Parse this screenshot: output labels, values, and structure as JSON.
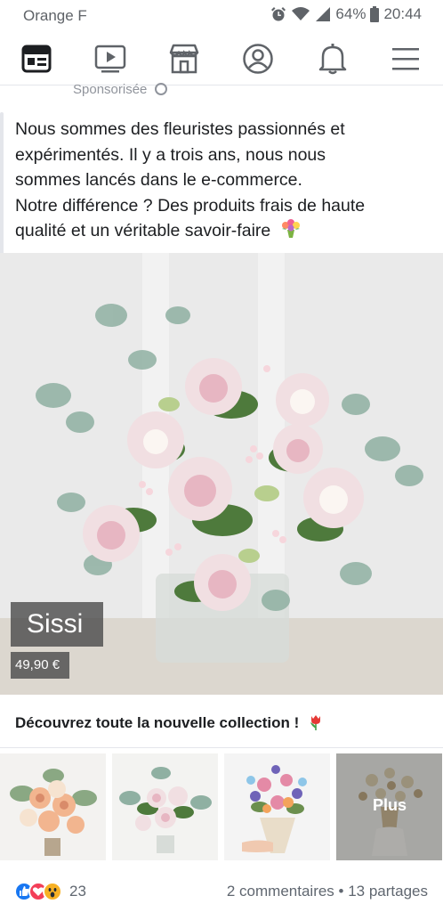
{
  "status_bar": {
    "carrier": "Orange F",
    "battery": "64%",
    "time": "20:44"
  },
  "nav": {
    "items": [
      {
        "name": "news-feed",
        "icon": "news-feed-icon"
      },
      {
        "name": "watch",
        "icon": "video-play-icon"
      },
      {
        "name": "marketplace",
        "icon": "store-icon"
      },
      {
        "name": "profile",
        "icon": "profile-icon"
      },
      {
        "name": "notifications",
        "icon": "bell-icon"
      },
      {
        "name": "menu",
        "icon": "hamburger-menu-icon"
      }
    ]
  },
  "post": {
    "sponsored_label": "Sponsorisée",
    "text_lines": [
      "Nous sommes des fleuristes passionnés et",
      "expérimentés. Il y a trois ans, nous nous",
      "sommes lancés dans le e-commerce.",
      "Notre différence ? Des produits frais de haute",
      "qualité et un véritable savoir-faire"
    ],
    "emoji_icon": "bouquet-emoji-icon",
    "product": {
      "name": "Sissi",
      "price": "49,90 €"
    },
    "collection": {
      "title": "Découvrez toute la nouvelle collection !",
      "emoji_icon": "tulip-emoji-icon"
    },
    "thumbnails": [
      {
        "name": "thumb-peach-bouquet"
      },
      {
        "name": "thumb-pastel-bouquet"
      },
      {
        "name": "thumb-colorful-bouquet"
      },
      {
        "name": "thumb-more",
        "label": "Plus"
      }
    ],
    "reactions": {
      "icons": [
        "like-icon",
        "love-icon",
        "wow-icon"
      ],
      "count": "23"
    },
    "stats": "2 commentaires • 13 partages"
  },
  "colors": {
    "like_blue": "#1877f2",
    "love_red": "#f33e58",
    "wow_yellow": "#f7b125",
    "text_secondary": "#606770"
  }
}
